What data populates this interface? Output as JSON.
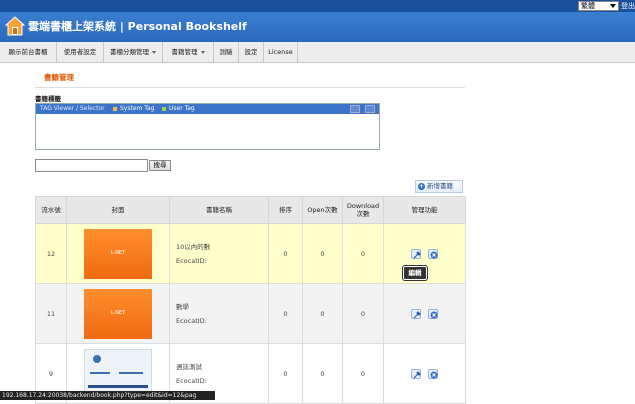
{
  "top_bar": {
    "language_value": "繁體",
    "logout_label": "登出"
  },
  "header": {
    "title": "雲端書櫃上架系統 | Personal Bookshelf"
  },
  "nav": {
    "items": [
      {
        "label": "顯示前台書櫃",
        "dropdown": false
      },
      {
        "label": "使用者設定",
        "dropdown": false
      },
      {
        "label": "書櫃分類管理",
        "dropdown": true
      },
      {
        "label": "書籍管理",
        "dropdown": true
      },
      {
        "label": "測驗",
        "dropdown": false
      },
      {
        "label": "設定",
        "dropdown": false
      },
      {
        "label": "License",
        "dropdown": false
      }
    ]
  },
  "main": {
    "page_title": "書籍管理",
    "tag_section_label": "書籍標籤",
    "tag_viewer_label": "TAG Viewer / Selector",
    "system_tag_label": "System Tag",
    "user_tag_label": "User Tag",
    "system_tag_color": "#f4b942",
    "user_tag_color": "#9bd14b",
    "search_value": "",
    "search_button": "搜尋",
    "add_book_button": "新增書籍",
    "table": {
      "headers": [
        "流水號",
        "封面",
        "書籍名稱",
        "排序",
        "Open次數",
        "Download 次數",
        "管理功能"
      ],
      "rows": [
        {
          "serial": "12",
          "cover_text": "L-NET",
          "title": "10以內的數",
          "id_label": "EcocatID:",
          "order": "0",
          "open": "0",
          "download": "0",
          "highlight": true
        },
        {
          "serial": "11",
          "cover_text": "L-NET",
          "title": "數學",
          "id_label": "EcocatID:",
          "order": "0",
          "open": "0",
          "download": "0",
          "highlight": false
        },
        {
          "serial": "9",
          "cover_text": "NU SKIN",
          "title": "週誌測試",
          "id_label": "EcocatID:",
          "order": "0",
          "open": "0",
          "download": "0",
          "highlight": false
        }
      ]
    },
    "tooltip_text": "編輯"
  },
  "status_bar": {
    "url": "192.168.17.24:20038/backend/book.php?type=edit&id=12&pag"
  }
}
